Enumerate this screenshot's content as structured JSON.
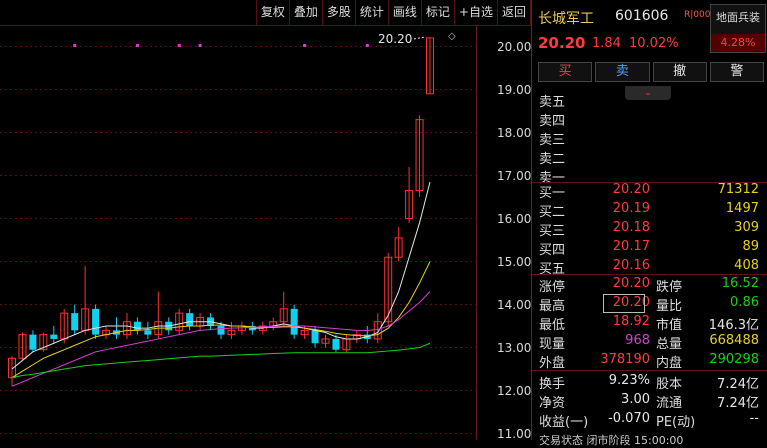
{
  "toolbar": [
    "复权",
    "叠加",
    "多股",
    "统计",
    "画线",
    "标记",
    "+自选",
    "返回"
  ],
  "axis": {
    "ticks": [
      20.0,
      19.0,
      18.0,
      17.0,
      16.0,
      15.0,
      14.0,
      13.0,
      12.0,
      11.0
    ],
    "ymin": 10.85,
    "ymax": 20.5
  },
  "chart_data": {
    "type": "candlestick",
    "last_price_label": "20.20",
    "ylim": [
      10.85,
      20.5
    ],
    "candles": [
      [
        12.3,
        12.75,
        12.1,
        12.8
      ],
      [
        12.75,
        13.3,
        12.7,
        13.35
      ],
      [
        13.3,
        12.95,
        12.9,
        13.4
      ],
      [
        12.95,
        13.3,
        12.9,
        13.35
      ],
      [
        13.3,
        13.2,
        13.1,
        13.5
      ],
      [
        13.2,
        13.8,
        13.1,
        13.9
      ],
      [
        13.8,
        13.4,
        13.3,
        14.0
      ],
      [
        13.4,
        13.9,
        13.3,
        14.9
      ],
      [
        13.9,
        13.3,
        13.2,
        14.0
      ],
      [
        13.3,
        13.4,
        13.2,
        13.5
      ],
      [
        13.4,
        13.3,
        13.2,
        13.7
      ],
      [
        13.3,
        13.6,
        13.2,
        13.8
      ],
      [
        13.6,
        13.4,
        13.3,
        13.7
      ],
      [
        13.4,
        13.3,
        13.2,
        13.6
      ],
      [
        13.3,
        13.6,
        13.2,
        14.3
      ],
      [
        13.6,
        13.4,
        13.3,
        13.7
      ],
      [
        13.4,
        13.8,
        13.3,
        13.9
      ],
      [
        13.8,
        13.5,
        13.4,
        13.9
      ],
      [
        13.5,
        13.7,
        13.4,
        13.8
      ],
      [
        13.7,
        13.5,
        13.4,
        13.8
      ],
      [
        13.5,
        13.3,
        13.2,
        13.6
      ],
      [
        13.3,
        13.4,
        13.2,
        13.6
      ],
      [
        13.4,
        13.5,
        13.3,
        13.6
      ],
      [
        13.5,
        13.4,
        13.3,
        13.6
      ],
      [
        13.4,
        13.5,
        13.3,
        13.6
      ],
      [
        13.5,
        13.6,
        13.4,
        13.7
      ],
      [
        13.6,
        13.9,
        13.5,
        14.3
      ],
      [
        13.9,
        13.3,
        13.2,
        14.0
      ],
      [
        13.3,
        13.4,
        13.2,
        13.5
      ],
      [
        13.4,
        13.1,
        13.0,
        13.5
      ],
      [
        13.1,
        13.2,
        13.0,
        13.3
      ],
      [
        13.2,
        12.95,
        12.9,
        13.3
      ],
      [
        12.95,
        13.2,
        12.9,
        13.3
      ],
      [
        13.2,
        13.3,
        13.1,
        13.4
      ],
      [
        13.3,
        13.2,
        13.1,
        13.5
      ],
      [
        13.2,
        13.6,
        13.1,
        13.8
      ],
      [
        13.6,
        15.1,
        13.5,
        15.2
      ],
      [
        15.1,
        15.55,
        15.0,
        15.8
      ],
      [
        16.0,
        16.65,
        15.9,
        17.2
      ],
      [
        16.65,
        18.3,
        16.5,
        18.4
      ],
      [
        18.9,
        20.2,
        18.9,
        20.2
      ]
    ],
    "ma_lines": [
      {
        "color": "#e6e6e6",
        "values": [
          12.5,
          12.7,
          12.9,
          13.0,
          13.1,
          13.2,
          13.3,
          13.4,
          13.45,
          13.5,
          13.5,
          13.5,
          13.45,
          13.45,
          13.5,
          13.5,
          13.55,
          13.6,
          13.6,
          13.6,
          13.55,
          13.5,
          13.5,
          13.45,
          13.45,
          13.5,
          13.55,
          13.5,
          13.45,
          13.4,
          13.35,
          13.25,
          13.2,
          13.2,
          13.25,
          13.35,
          13.75,
          14.3,
          15.1,
          15.9,
          16.85
        ]
      },
      {
        "color": "#e6d21a",
        "values": [
          12.3,
          12.45,
          12.6,
          12.75,
          12.85,
          12.95,
          13.05,
          13.15,
          13.25,
          13.3,
          13.35,
          13.4,
          13.4,
          13.42,
          13.45,
          13.45,
          13.48,
          13.5,
          13.5,
          13.52,
          13.52,
          13.5,
          13.5,
          13.48,
          13.47,
          13.47,
          13.48,
          13.48,
          13.45,
          13.42,
          13.38,
          13.33,
          13.3,
          13.28,
          13.27,
          13.3,
          13.45,
          13.7,
          14.05,
          14.5,
          15.0
        ]
      },
      {
        "color": "#d040d0",
        "values": [
          12.1,
          12.2,
          12.3,
          12.4,
          12.5,
          12.6,
          12.7,
          12.8,
          12.9,
          12.95,
          13.0,
          13.05,
          13.1,
          13.15,
          13.2,
          13.25,
          13.3,
          13.35,
          13.4,
          13.42,
          13.44,
          13.45,
          13.46,
          13.47,
          13.48,
          13.49,
          13.5,
          13.5,
          13.5,
          13.48,
          13.46,
          13.44,
          13.42,
          13.4,
          13.4,
          13.42,
          13.5,
          13.65,
          13.85,
          14.05,
          14.3
        ]
      },
      {
        "color": "#18d018",
        "values": [
          12.3,
          12.35,
          12.38,
          12.42,
          12.46,
          12.5,
          12.54,
          12.58,
          12.6,
          12.62,
          12.64,
          12.66,
          12.68,
          12.7,
          12.72,
          12.74,
          12.76,
          12.78,
          12.8,
          12.8,
          12.81,
          12.82,
          12.83,
          12.84,
          12.85,
          12.86,
          12.87,
          12.88,
          12.88,
          12.88,
          12.88,
          12.88,
          12.88,
          12.88,
          12.88,
          12.9,
          12.92,
          12.94,
          12.97,
          13.0,
          13.1
        ]
      }
    ]
  },
  "stock": {
    "name": "长城军工",
    "code": "601606",
    "badge": "R|000",
    "price": "20.20",
    "change": "1.84",
    "pct": "10.02%"
  },
  "sector": {
    "name": "地面兵装",
    "pct": "4.28%"
  },
  "trade_buttons": [
    "买",
    "卖",
    "撤",
    "警"
  ],
  "collapse_icon": "chevron-down",
  "asks": [
    {
      "label": "卖五",
      "price": "",
      "vol": ""
    },
    {
      "label": "卖四",
      "price": "",
      "vol": ""
    },
    {
      "label": "卖三",
      "price": "",
      "vol": ""
    },
    {
      "label": "卖二",
      "price": "",
      "vol": ""
    },
    {
      "label": "卖一",
      "price": "",
      "vol": ""
    }
  ],
  "bids": [
    {
      "label": "买一",
      "price": "20.20",
      "vol": "71312"
    },
    {
      "label": "买二",
      "price": "20.19",
      "vol": "1497"
    },
    {
      "label": "买三",
      "price": "20.18",
      "vol": "309"
    },
    {
      "label": "买四",
      "price": "20.17",
      "vol": "89"
    },
    {
      "label": "买五",
      "price": "20.16",
      "vol": "408"
    }
  ],
  "stats1": [
    {
      "l1": "涨停",
      "v1": "20.20",
      "c1": "red",
      "l2": "跌停",
      "v2": "16.52",
      "c2": "green"
    },
    {
      "l1": "最高",
      "v1": "20.20",
      "c1": "red",
      "l2": "量比",
      "v2": "0.86",
      "c2": "green"
    },
    {
      "l1": "最低",
      "v1": "18.92",
      "c1": "red",
      "l2": "市值",
      "v2": "146.3亿",
      "c2": "white"
    },
    {
      "l1": "现量",
      "v1": "968",
      "c1": "purple",
      "l2": "总量",
      "v2": "668488",
      "c2": "yellow"
    },
    {
      "l1": "外盘",
      "v1": "378190",
      "c1": "red",
      "l2": "内盘",
      "v2": "290298",
      "c2": "green"
    }
  ],
  "stats2": [
    {
      "l1": "换手",
      "v1": "9.23%",
      "c1": "white",
      "l2": "股本",
      "v2": "7.24亿",
      "c2": "white"
    },
    {
      "l1": "净资",
      "v1": "3.00",
      "c1": "white",
      "l2": "流通",
      "v2": "7.24亿",
      "c2": "white"
    },
    {
      "l1": "收益(一)",
      "v1": "-0.070",
      "c1": "white",
      "l2": "PE(动)",
      "v2": "--",
      "c2": "white"
    }
  ],
  "bottom_text": "交易状态  闭市阶段  15:00:00"
}
